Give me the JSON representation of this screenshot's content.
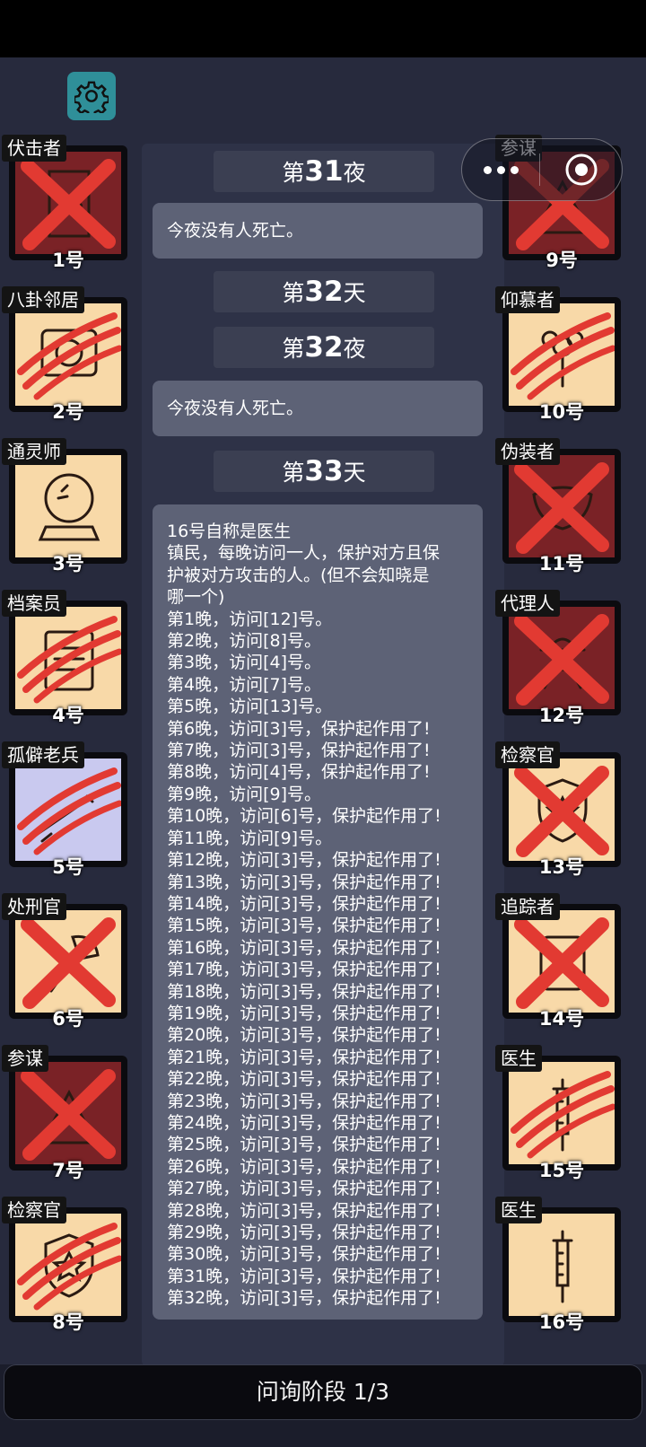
{
  "title_bar": {
    "settings_icon": "gear-icon"
  },
  "mini_program_menu": {
    "more_icon": "more-dots-icon",
    "close_icon": "target-circle-icon"
  },
  "log": {
    "phases": [
      {
        "prefix": "第",
        "num": "31",
        "suffix": "夜"
      },
      {
        "prefix": "第",
        "num": "32",
        "suffix": "天"
      },
      {
        "prefix": "第",
        "num": "32",
        "suffix": "夜"
      },
      {
        "prefix": "第",
        "num": "33",
        "suffix": "天"
      }
    ],
    "night31_message": "今夜没有人死亡。",
    "night32_message": "今夜没有人死亡。",
    "claim_lines": [
      "16号自称是医生",
      "镇民，每晚访问一人，保护对方且保",
      "护被对方攻击的人。(但不会知晓是",
      "哪一个)",
      "第1晚，访问[12]号。",
      "第2晚，访问[8]号。",
      "第3晚，访问[4]号。",
      "第4晚，访问[7]号。",
      "第5晚，访问[13]号。",
      "第6晚，访问[3]号，保护起作用了!",
      "第7晚，访问[3]号，保护起作用了!",
      "第8晚，访问[4]号，保护起作用了!",
      "第9晚，访问[9]号。",
      "第10晚，访问[6]号，保护起作用了!",
      "第11晚，访问[9]号。",
      "第12晚，访问[3]号，保护起作用了!",
      "第13晚，访问[3]号，保护起作用了!",
      "第14晚，访问[3]号，保护起作用了!",
      "第15晚，访问[3]号，保护起作用了!",
      "第16晚，访问[3]号，保护起作用了!",
      "第17晚，访问[3]号，保护起作用了!",
      "第18晚，访问[3]号，保护起作用了!",
      "第19晚，访问[3]号，保护起作用了!",
      "第20晚，访问[3]号，保护起作用了!",
      "第21晚，访问[3]号，保护起作用了!",
      "第22晚，访问[3]号，保护起作用了!",
      "第23晚，访问[3]号，保护起作用了!",
      "第24晚，访问[3]号，保护起作用了!",
      "第25晚，访问[3]号，保护起作用了!",
      "第26晚，访问[3]号，保护起作用了!",
      "第27晚，访问[3]号，保护起作用了!",
      "第28晚，访问[3]号，保护起作用了!",
      "第29晚，访问[3]号，保护起作用了!",
      "第30晚，访问[3]号，保护起作用了!",
      "第31晚，访问[3]号，保护起作用了!",
      "第32晚，访问[3]号，保护起作用了!"
    ]
  },
  "players_left": [
    {
      "role": "伏击者",
      "number": "1号",
      "status": "dead",
      "icon": "door-icon",
      "bg": "#7a2226"
    },
    {
      "role": "八卦邻居",
      "number": "2号",
      "status": "clawed",
      "icon": "gossip-icon",
      "bg": "#f8d9a8"
    },
    {
      "role": "通灵师",
      "number": "3号",
      "status": "alive",
      "icon": "crystal-ball-icon",
      "bg": "#f8d9a8"
    },
    {
      "role": "档案员",
      "number": "4号",
      "status": "clawed",
      "icon": "archive-icon",
      "bg": "#f8d9a8"
    },
    {
      "role": "孤僻老兵",
      "number": "5号",
      "status": "clawed",
      "icon": "rifle-icon",
      "bg": "#c9c9ef"
    },
    {
      "role": "处刑官",
      "number": "6号",
      "status": "dead",
      "icon": "axe-icon",
      "bg": "#f8d9a8"
    },
    {
      "role": "参谋",
      "number": "7号",
      "status": "dead",
      "icon": "advisor-icon",
      "bg": "#7a2226"
    },
    {
      "role": "检察官",
      "number": "8号",
      "status": "clawed",
      "icon": "badge-icon",
      "bg": "#f8d9a8"
    }
  ],
  "players_right": [
    {
      "role": "参谋",
      "number": "9号",
      "status": "dead",
      "icon": "advisor-icon",
      "bg": "#7a2226"
    },
    {
      "role": "仰慕者",
      "number": "10号",
      "status": "clawed",
      "icon": "flower-icon",
      "bg": "#f8d9a8"
    },
    {
      "role": "伪装者",
      "number": "11号",
      "status": "dead",
      "icon": "mask-icon",
      "bg": "#7a2226"
    },
    {
      "role": "代理人",
      "number": "12号",
      "status": "dead",
      "icon": "agent-icon",
      "bg": "#7a2226"
    },
    {
      "role": "检察官",
      "number": "13号",
      "status": "dead",
      "icon": "badge-icon",
      "bg": "#f8d9a8"
    },
    {
      "role": "追踪者",
      "number": "14号",
      "status": "dead",
      "icon": "scroll-icon",
      "bg": "#f8d9a8"
    },
    {
      "role": "医生",
      "number": "15号",
      "status": "clawed",
      "icon": "syringe-icon",
      "bg": "#f8d9a8"
    },
    {
      "role": "医生",
      "number": "16号",
      "status": "alive",
      "icon": "syringe-icon",
      "bg": "#f8d9a8"
    }
  ],
  "footer": {
    "phase_label": "问询阶段 1/3"
  },
  "colors": {
    "page_bg": "#272a3d",
    "accent_teal": "#2f8f99",
    "mark_red": "#e23a32"
  }
}
